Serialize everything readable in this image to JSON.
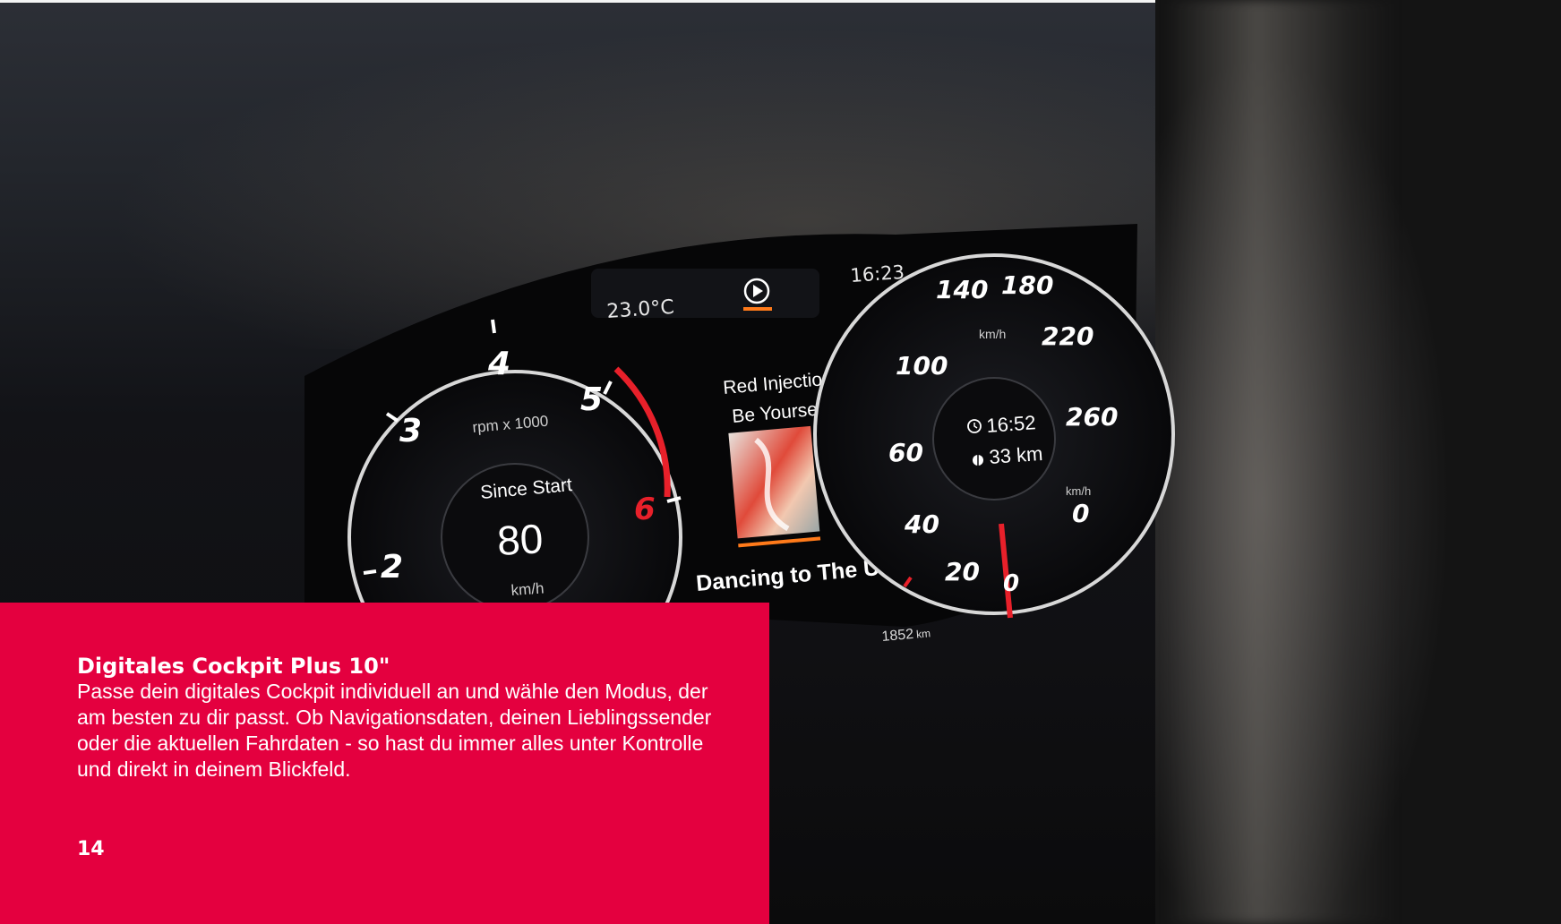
{
  "cluster": {
    "outside_temperature": "23.0°C",
    "clock": "16:23",
    "tachometer": {
      "ticks": [
        "2",
        "3",
        "4",
        "5",
        "6"
      ],
      "unit_label": "rpm x 1000",
      "panel_title": "Since Start",
      "panel_value": "80",
      "panel_unit": "km/h"
    },
    "media": {
      "station": "Red Injection",
      "track_title": "Be Yourself",
      "now_playing": "Dancing to The Ur..."
    },
    "speedometer": {
      "ticks": [
        "20",
        "40",
        "60",
        "100",
        "140",
        "180",
        "220",
        "260"
      ],
      "unit_label": "km/h",
      "arrival_time": "16:52",
      "distance": "33 km",
      "digital_speed_unit": "km/h",
      "digital_speed": "0",
      "zero_label": "0"
    },
    "odometer_value": "1852",
    "odometer_unit": "km"
  },
  "overlay": {
    "title": "Digitales Cockpit Plus 10\"",
    "body": "Passe dein digitales Cockpit individuell an und wähle den Modus, der am besten zu dir passt. Ob Navigationsdaten, deinen Lieblingssender oder die aktuellen Fahrdaten - so hast du immer alles unter Kontrolle und direkt in deinem Blickfeld.",
    "page_number": "14"
  },
  "colors": {
    "accent_red": "#e4003f",
    "gauge_red": "#e8202a",
    "media_orange": "#ff7a1a"
  }
}
